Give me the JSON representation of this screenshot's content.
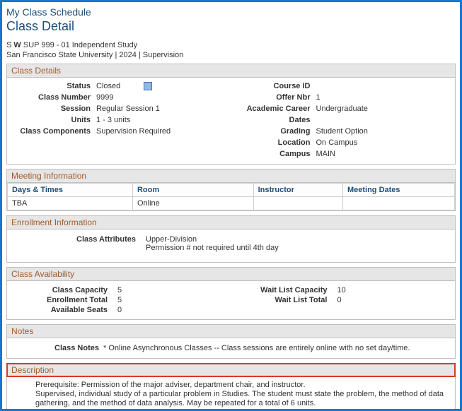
{
  "page": {
    "title": "My Class Schedule",
    "subtitle": "Class Detail",
    "courseLine": {
      "prefix": "S",
      "bold": "W",
      "rest": " SUP  999 - 01   Independent Study"
    },
    "univLine": "San Francisco State University | 2024 | Supervision"
  },
  "classDetails": {
    "header": "Class Details",
    "left": {
      "statusLabel": "Status",
      "statusValue": "Closed",
      "numberLabel": "Class Number",
      "numberValue": "9999",
      "sessionLabel": "Session",
      "sessionValue": "Regular Session 1",
      "unitsLabel": "Units",
      "unitsValue": "1 - 3 units",
      "componentsLabel": "Class Components",
      "componentsValue": "Supervision Required"
    },
    "right": {
      "courseIdLabel": "Course ID",
      "courseIdValue": "",
      "offerNbrLabel": "Offer Nbr",
      "offerNbrValue": "1",
      "careerLabel": "Academic Career",
      "careerValue": "Undergraduate",
      "datesLabel": "Dates",
      "datesValue": "",
      "gradingLabel": "Grading",
      "gradingValue": "Student Option",
      "locationLabel": "Location",
      "locationValue": "On Campus",
      "campusLabel": "Campus",
      "campusValue": "MAIN"
    }
  },
  "meeting": {
    "header": "Meeting Information",
    "cols": {
      "daysTimes": "Days & Times",
      "room": "Room",
      "instructor": "Instructor",
      "dates": "Meeting Dates"
    },
    "row": {
      "daysTimes": "TBA",
      "room": "Online",
      "instructor": "",
      "dates": ""
    }
  },
  "enrollment": {
    "header": "Enrollment Information",
    "attrLabel": "Class Attributes",
    "attr1": "Upper-Division",
    "attr2": "Permission # not required until 4th day"
  },
  "availability": {
    "header": "Class Availability",
    "left": {
      "capacityLabel": "Class Capacity",
      "capacityValue": "5",
      "enrollLabel": "Enrollment Total",
      "enrollValue": "5",
      "seatsLabel": "Available Seats",
      "seatsValue": "0"
    },
    "right": {
      "wlCapLabel": "Wait List Capacity",
      "wlCapValue": "10",
      "wlTotLabel": "Wait List Total",
      "wlTotValue": "0"
    }
  },
  "notes": {
    "header": "Notes",
    "label": "Class Notes",
    "text": "* Online Asynchronous Classes -- Class sessions are entirely online with no set day/time."
  },
  "description": {
    "header": "Description",
    "line1": "Prerequisite: Permission of the major adviser, department chair, and instructor.",
    "line2": "Supervised, individual study of a particular problem in Studies. The student must state the problem, the method of data gathering, and the method of data analysis. May be repeated for a total of 6 units."
  }
}
